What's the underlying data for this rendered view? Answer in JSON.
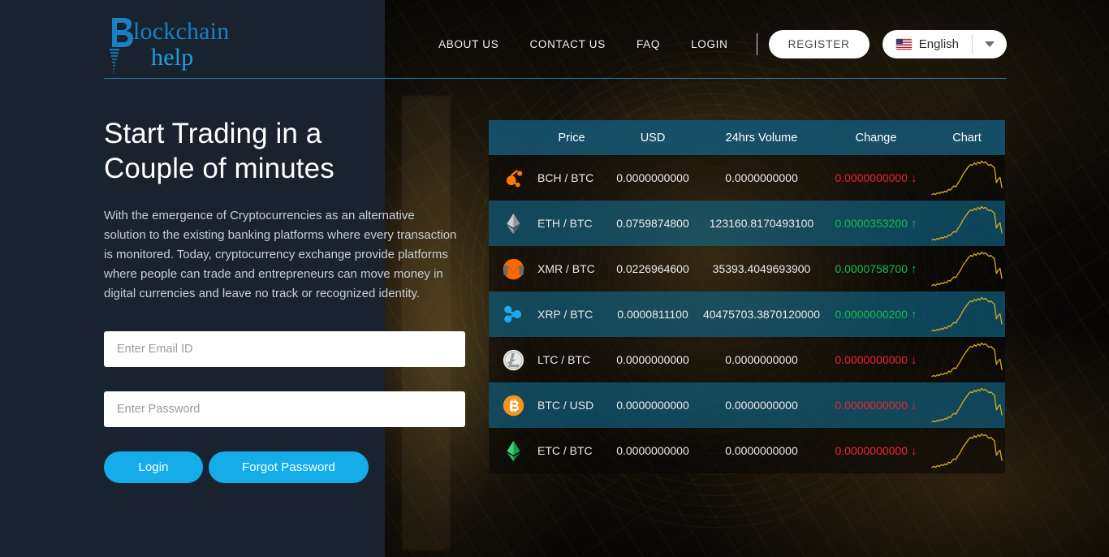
{
  "brand": {
    "logo_line1": "lockchain",
    "logo_line2": "help",
    "logo_mark": "stylized-b-icon",
    "accent_color": "#14adea",
    "logo_color": "#1b7fc4"
  },
  "nav": {
    "links": [
      {
        "label": "ABOUT US",
        "name": "nav-about-us"
      },
      {
        "label": "CONTACT US",
        "name": "nav-contact-us"
      },
      {
        "label": "FAQ",
        "name": "nav-faq"
      },
      {
        "label": "LOGIN",
        "name": "nav-login"
      }
    ],
    "register_label": "REGISTER",
    "language": {
      "label": "English",
      "flag": "us-flag-icon",
      "caret": "chevron-down-icon"
    }
  },
  "hero": {
    "title": "Start Trading in a Couple of minutes",
    "body": "With the emergence of Cryptocurrencies as an alternative solution to the existing banking platforms where every transaction is monitored. Today, cryptocurrency exchange provide platforms where people can trade and entrepreneurs can move money in digital currencies and leave no track or recognized identity.",
    "form": {
      "email_placeholder": "Enter Email ID",
      "email_value": "",
      "password_placeholder": "Enter Password",
      "password_value": "",
      "login_label": "Login",
      "forgot_label": "Forgot Password"
    }
  },
  "market": {
    "headers": [
      "Price",
      "USD",
      "24hrs Volume",
      "Change",
      "Chart"
    ],
    "rows": [
      {
        "icon": "bch-icon",
        "pair": "BCH / BTC",
        "usd": "0.0000000000",
        "volume": "0.0000000000",
        "change": "0.0000000000",
        "direction": "down"
      },
      {
        "icon": "eth-icon",
        "pair": "ETH / BTC",
        "usd": "0.0759874800",
        "volume": "123160.8170493100",
        "change": "0.0000353200",
        "direction": "up"
      },
      {
        "icon": "xmr-icon",
        "pair": "XMR / BTC",
        "usd": "0.0226964600",
        "volume": "35393.4049693900",
        "change": "0.0000758700",
        "direction": "up"
      },
      {
        "icon": "xrp-icon",
        "pair": "XRP / BTC",
        "usd": "0.0000811100",
        "volume": "40475703.3870120000",
        "change": "0.0000000200",
        "direction": "up"
      },
      {
        "icon": "ltc-icon",
        "pair": "LTC / BTC",
        "usd": "0.0000000000",
        "volume": "0.0000000000",
        "change": "0.0000000000",
        "direction": "down"
      },
      {
        "icon": "btc-icon",
        "pair": "BTC / USD",
        "usd": "0.0000000000",
        "volume": "0.0000000000",
        "change": "0.0000000000",
        "direction": "down"
      },
      {
        "icon": "etc-icon",
        "pair": "ETC / BTC",
        "usd": "0.0000000000",
        "volume": "0.0000000000",
        "change": "0.0000000000",
        "direction": "down"
      }
    ],
    "colors": {
      "header_bg": "#14536e",
      "row_alt_bg": "#0e526e",
      "up": "#13bb4f",
      "down": "#ee2233",
      "sparkline": "#d6a81f"
    },
    "sparkline_values": [
      6,
      7,
      6,
      8,
      7,
      9,
      8,
      10,
      9,
      12,
      11,
      14,
      16,
      15,
      19,
      22,
      26,
      30,
      33,
      36,
      39,
      41,
      40,
      43,
      41,
      44,
      42,
      45,
      43,
      44,
      42,
      40,
      41,
      39,
      37,
      20,
      24,
      26,
      14
    ]
  }
}
